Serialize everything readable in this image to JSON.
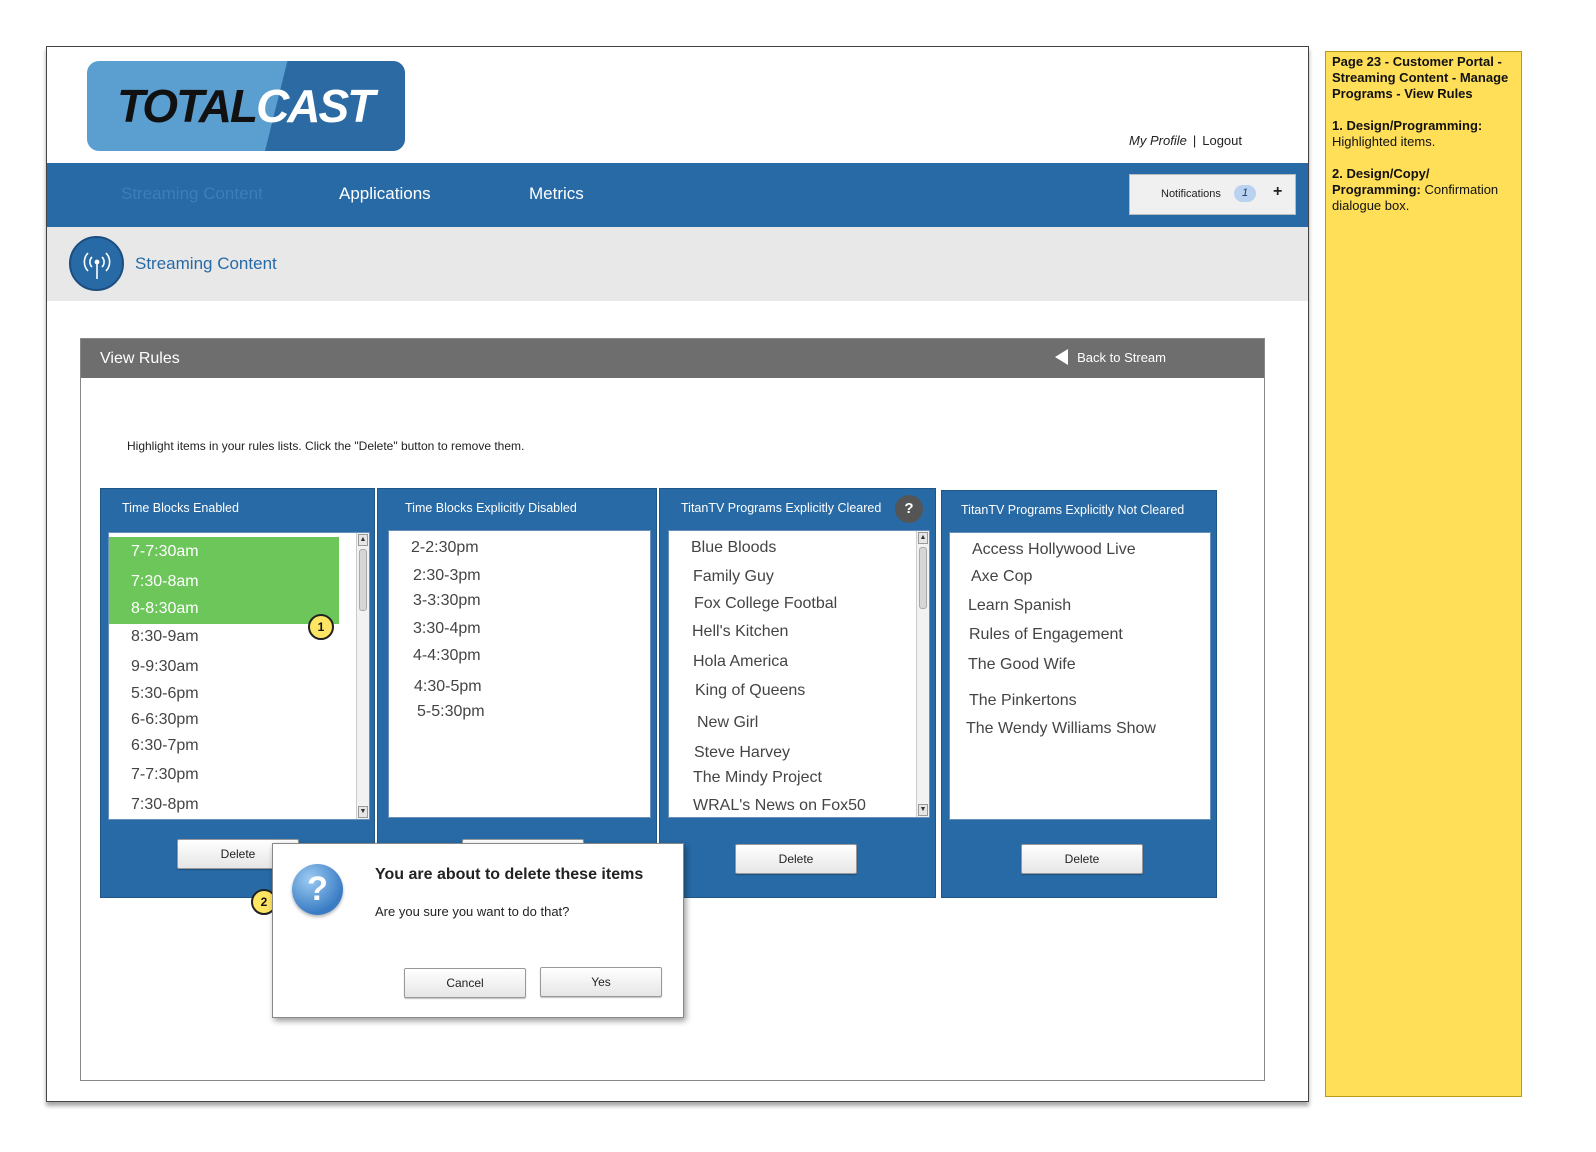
{
  "logo": {
    "part1": "TOTAL",
    "part2": "CAST"
  },
  "top_links": {
    "my_profile": "My Profile",
    "separator": "|",
    "logout": "Logout"
  },
  "nav": {
    "items": [
      "Streaming Content",
      "Applications",
      "Metrics"
    ],
    "active": "Streaming Content",
    "notifications": {
      "label": "Notifications",
      "count": "1",
      "add": "+"
    }
  },
  "subheader": {
    "icon": "broadcast-icon",
    "title": "Streaming Content"
  },
  "panel": {
    "title": "View Rules",
    "back_link": "Back to Stream",
    "instructions": "Highlight items in your rules lists. Click the \"Delete\" button to remove them."
  },
  "columns": [
    {
      "title": "Time Blocks Enabled",
      "items": [
        "7-7:30am",
        "7:30-8am",
        "8-8:30am",
        "8:30-9am",
        "9-9:30am",
        "5:30-6pm",
        "6-6:30pm",
        "6:30-7pm",
        "7-7:30pm",
        "7:30-8pm"
      ],
      "selected": [
        "7-7:30am",
        "7:30-8am",
        "8-8:30am"
      ],
      "button": "Delete"
    },
    {
      "title": "Time Blocks Explicitly Disabled",
      "items": [
        "2-2:30pm",
        "2:30-3pm",
        "3-3:30pm",
        "3:30-4pm",
        "4-4:30pm",
        "4:30-5pm",
        "5-5:30pm"
      ],
      "button": ""
    },
    {
      "title": "TitanTV Programs Explicitly Cleared",
      "help": "?",
      "items": [
        "Blue Bloods",
        "Family Guy",
        "Fox College Footbal",
        "Hell's Kitchen",
        "Hola America",
        "King of Queens",
        "New Girl",
        "Steve Harvey",
        "The Mindy Project",
        "WRAL's News on Fox50"
      ],
      "button": "Delete"
    },
    {
      "title": "TitanTV Programs Explicitly Not Cleared",
      "items": [
        "Access Hollywood Live",
        "Axe Cop",
        "Learn Spanish",
        "Rules of Engagement",
        "The Good Wife",
        "The Pinkertons",
        "The Wendy Williams Show"
      ],
      "button": "Delete"
    }
  ],
  "callouts": [
    "1",
    "2"
  ],
  "dialog": {
    "icon": "question-icon",
    "title": "You are about to delete these items",
    "message": "Are you sure you want to do that?",
    "cancel": "Cancel",
    "yes": "Yes"
  },
  "side_note": {
    "heading": "Page 23 - Customer Portal - Streaming Content - Manage Programs - View Rules",
    "items": [
      {
        "label": "1. Design/Programming:",
        "text": "Highlighted items."
      },
      {
        "label": "2. Design/Copy/ Programming:",
        "text": "Confirmation dialogue box."
      }
    ]
  },
  "colors": {
    "nav_blue": "#276aa6",
    "selected_green": "#6cc65a",
    "note_yellow": "#ffdf58",
    "panel_header_gray": "#6e6e6e"
  }
}
